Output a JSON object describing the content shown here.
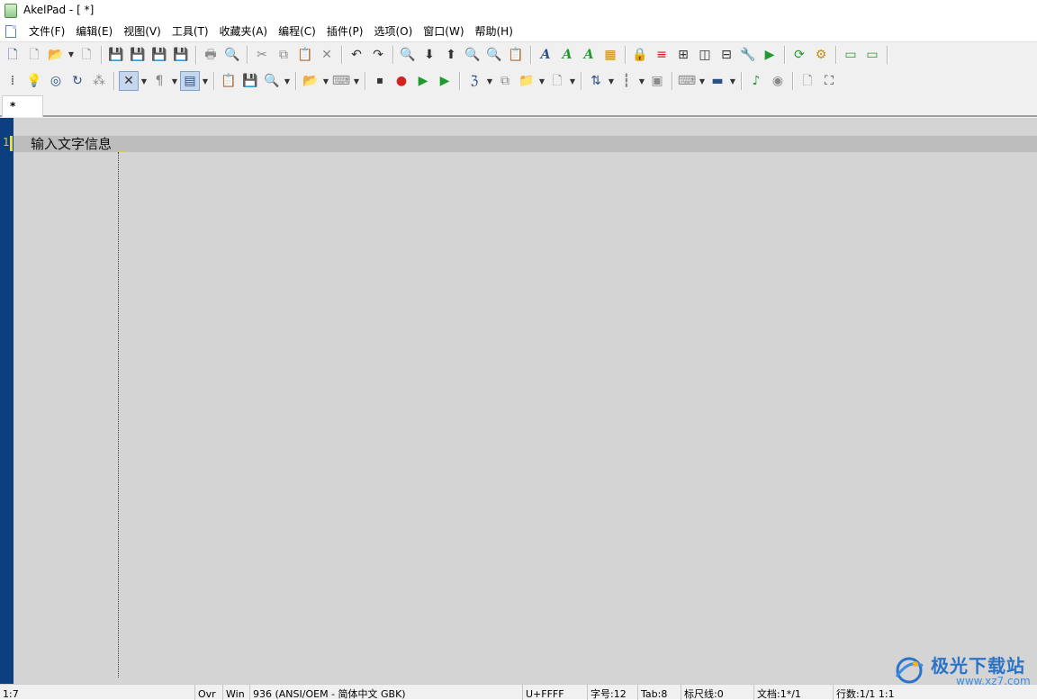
{
  "window": {
    "title": "AkelPad - [ *]"
  },
  "menu": {
    "items": [
      "文件(F)",
      "编辑(E)",
      "视图(V)",
      "工具(T)",
      "收藏夹(A)",
      "编程(C)",
      "插件(P)",
      "选项(O)",
      "窗口(W)",
      "帮助(H)"
    ]
  },
  "toolbar1": {
    "glyphs": {
      "new": "🗋",
      "open": "📂",
      "save": "💾",
      "print": "🖶",
      "cut": "✂",
      "copy": "⧉",
      "paste": "📋",
      "delete": "✕",
      "undo": "↶",
      "redo": "↷",
      "find": "🔍",
      "down": "⬇",
      "up": "⬆",
      "italic_a": "A",
      "play": "▶",
      "gear": "⚙"
    }
  },
  "toolbar2": {
    "glyphs": {
      "pilcrow": "¶",
      "record": "●",
      "play": "▶",
      "note": "♪",
      "wrap": "✕"
    }
  },
  "tab": {
    "label": "*"
  },
  "editor": {
    "line_number": "1",
    "lines": [
      "输入文字信息"
    ]
  },
  "statusbar": {
    "position": "1:7",
    "mode": "Ovr",
    "newline": "Win",
    "codepage": "936   (ANSI/OEM - 简体中文 GBK)",
    "unicode": "U+FFFF",
    "font_size": "字号:12",
    "tab_size": "Tab:8",
    "ruler": "标尺线:0",
    "document": "文档:1*/1",
    "line_count": "行数:1/1 1:1"
  },
  "watermark": {
    "name": "极光下载站",
    "url": "www.xz7.com"
  },
  "colors": {
    "gutter": "#0b3f7f",
    "line_number": "#d8c84c",
    "editor_bg": "#d4d4d4",
    "current_line": "#bdbdbd",
    "watermark": "#2a74c8"
  }
}
